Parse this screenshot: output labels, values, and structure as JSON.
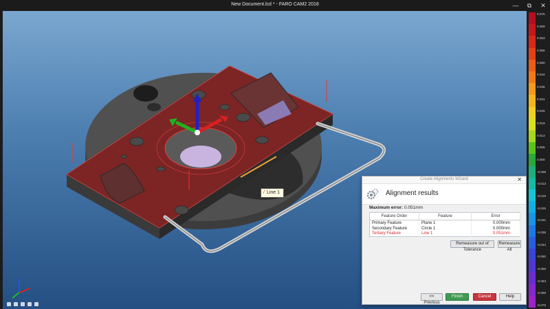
{
  "window": {
    "title": "New Document.lcd * - FARO CAM2 2018",
    "controls": [
      "—",
      "⧉",
      "✕"
    ]
  },
  "viewport": {
    "callout_label": "Line 1",
    "background_top": "#7aa7cf",
    "background_bottom": "#244f83"
  },
  "dialog": {
    "title": "Create Alignments Wizard",
    "close": "✕",
    "heading": "Alignment results",
    "max_error_label": "Maximum error:",
    "max_error_value": "0.051mm",
    "columns": [
      "Feature Order",
      "Feature",
      "Error"
    ],
    "rows": [
      {
        "order": "Primary Feature",
        "feature": "Plane 1",
        "error": "0.000mm",
        "out_of_tolerance": false
      },
      {
        "order": "Secondary Feature",
        "feature": "Circle 1",
        "error": "0.000mm",
        "out_of_tolerance": false
      },
      {
        "order": "Tertiary Feature",
        "feature": "Line 1",
        "error": "0.051mm",
        "out_of_tolerance": true
      }
    ],
    "remeasure_out_label": "Remeasure out of Tolerance",
    "remeasure_all_label": "Remeasure All",
    "previous_label": "<< Previous",
    "finish_label": "Finish",
    "cancel_label": "Cancel",
    "help_label": "Help"
  },
  "scale": {
    "labels": [
      "0.075",
      "0.069",
      "0.063",
      "0.056",
      "0.050",
      "0.044",
      "0.038",
      "0.031",
      "0.025",
      "0.019",
      "0.013",
      "0.006",
      "0.000",
      "-0.006",
      "-0.013",
      "-0.019",
      "-0.025",
      "-0.031",
      "-0.038",
      "-0.044",
      "-0.050",
      "-0.056",
      "-0.063",
      "-0.069",
      "-0.075"
    ],
    "colors": [
      "#b01020",
      "#c4181c",
      "#d8281a",
      "#e2401a",
      "#ec5c18",
      "#f07a18",
      "#f49a1c",
      "#f4b61e",
      "#f0d020",
      "#d8e020",
      "#a6d81c",
      "#5cc21e",
      "#2aa83a",
      "#1fae78",
      "#18b8a8",
      "#14c4d4",
      "#12aee6",
      "#1894e8",
      "#2078e4",
      "#2a5ce0",
      "#3a44d8",
      "#5036d2",
      "#6a2ed0",
      "#8428cc",
      "#9c24c8"
    ]
  }
}
